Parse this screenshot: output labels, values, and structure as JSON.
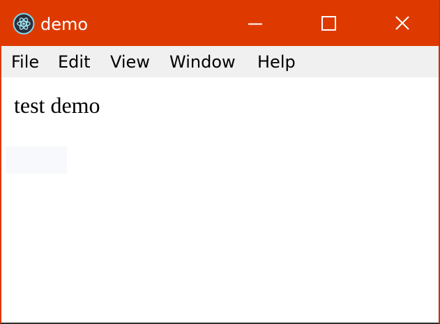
{
  "window": {
    "title": "demo",
    "app_icon": "electron-atom-icon",
    "accent_color": "#de3a00",
    "controls": {
      "minimize_icon": "minimize-icon",
      "maximize_icon": "maximize-icon",
      "close_icon": "close-icon"
    }
  },
  "menu": {
    "items": [
      {
        "label": "File"
      },
      {
        "label": "Edit"
      },
      {
        "label": "View"
      },
      {
        "label": "Window"
      },
      {
        "label": "Help"
      }
    ]
  },
  "content": {
    "text": "test demo"
  }
}
